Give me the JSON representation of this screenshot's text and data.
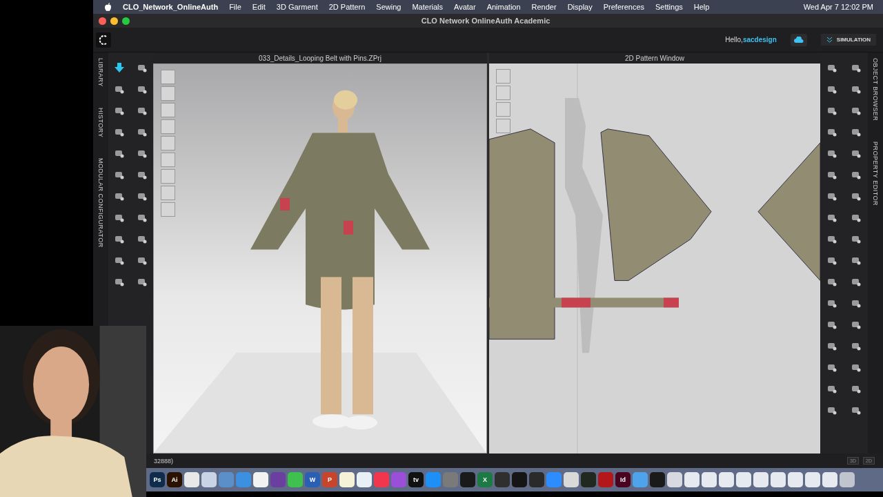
{
  "menubar": {
    "app": "CLO_Network_OnlineAuth",
    "menus": [
      "File",
      "Edit",
      "3D Garment",
      "2D Pattern",
      "Sewing",
      "Materials",
      "Avatar",
      "Animation",
      "Render",
      "Display",
      "Preferences",
      "Settings",
      "Help"
    ],
    "clock": "Wed Apr 7  12:02 PM"
  },
  "window": {
    "title": "CLO Network OnlineAuth Academic"
  },
  "toolbar": {
    "greeting": "Hello,",
    "user": "sacdesign",
    "mode": "SIMULATION"
  },
  "left_tabs": [
    "LIBRARY",
    "HISTORY",
    "MODULAR CONFIGURATOR"
  ],
  "right_tabs": [
    "OBJECT BROWSER",
    "PROPERTY EDITOR"
  ],
  "viewport_3d": {
    "title": "033_Details_Looping Belt with Pins.ZPrj"
  },
  "pattern_window": {
    "title": "2D Pattern Window"
  },
  "status_bar": {
    "text": "32888)",
    "buttons": [
      "3D",
      "2D"
    ]
  },
  "dock": [
    {
      "label": "Ps",
      "color": "#0f2c4c"
    },
    {
      "label": "Ai",
      "color": "#2b1200"
    },
    {
      "color": "#e8e8e8"
    },
    {
      "color": "#c9d3e6"
    },
    {
      "color": "#5a8fc9"
    },
    {
      "color": "#3d8fe0"
    },
    {
      "color": "#f2f2f2"
    },
    {
      "color": "#6b3fa0"
    },
    {
      "color": "#3fc14f"
    },
    {
      "label": "W",
      "color": "#2b5fb4"
    },
    {
      "label": "P",
      "color": "#c8452b"
    },
    {
      "color": "#f5f0d8"
    },
    {
      "color": "#e9f0f5"
    },
    {
      "color": "#f1364e"
    },
    {
      "color": "#9b4fd8"
    },
    {
      "label": "tv",
      "color": "#111111"
    },
    {
      "color": "#1d8ff5"
    },
    {
      "color": "#7a7a7a"
    },
    {
      "color": "#1a1a1a"
    },
    {
      "label": "X",
      "color": "#1e7a44"
    },
    {
      "color": "#2f2f2f"
    },
    {
      "color": "#151515"
    },
    {
      "color": "#2a2a2a"
    },
    {
      "color": "#2d8cff"
    },
    {
      "color": "#d9d9d9"
    },
    {
      "color": "#202820"
    },
    {
      "color": "#b3161b"
    },
    {
      "label": "Id",
      "color": "#49021f"
    },
    {
      "color": "#4fa3ea"
    },
    {
      "color": "#1a1a1a"
    },
    {
      "color": "#d8d8e0"
    },
    {
      "color": "#e6e9ef"
    },
    {
      "color": "#e6e9ef"
    },
    {
      "color": "#e6e9ef"
    },
    {
      "color": "#e6e9ef"
    },
    {
      "color": "#e6e9ef"
    },
    {
      "color": "#e6e9ef"
    },
    {
      "color": "#e6e9ef"
    },
    {
      "color": "#e6e9ef"
    },
    {
      "color": "#e6e9ef"
    },
    {
      "color": "#c0c4cc"
    }
  ]
}
